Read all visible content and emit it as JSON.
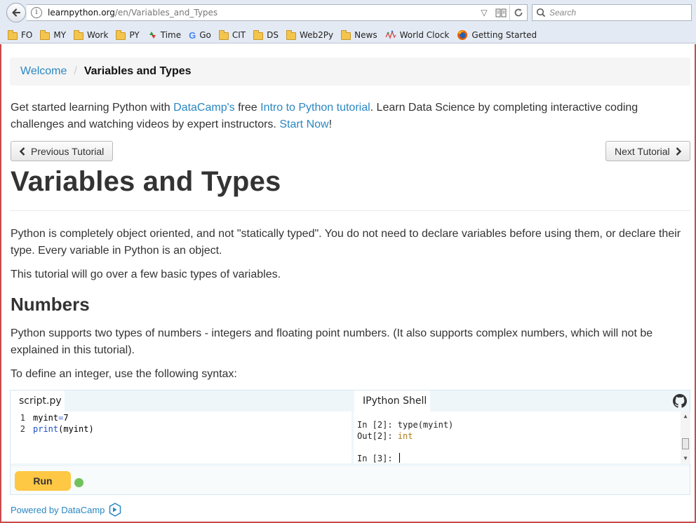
{
  "browser": {
    "url_host": "learnpython.org",
    "url_path": "/en/Variables_and_Types",
    "search_placeholder": "Search",
    "bookmarks": [
      {
        "label": "FO",
        "icon": "folder-icon"
      },
      {
        "label": "MY",
        "icon": "folder-icon"
      },
      {
        "label": "Work",
        "icon": "folder-icon"
      },
      {
        "label": "PY",
        "icon": "folder-icon"
      },
      {
        "label": "Time",
        "icon": "time-site-icon"
      },
      {
        "label": "Go",
        "icon": "google-icon"
      },
      {
        "label": "CIT",
        "icon": "folder-icon"
      },
      {
        "label": "DS",
        "icon": "folder-icon"
      },
      {
        "label": "Web2Py",
        "icon": "folder-icon"
      },
      {
        "label": "News",
        "icon": "folder-icon"
      },
      {
        "label": "World Clock",
        "icon": "world-clock-icon"
      },
      {
        "label": "Getting Started",
        "icon": "firefox-icon"
      }
    ]
  },
  "breadcrumb": {
    "home": "Welcome",
    "current": "Variables and Types"
  },
  "intro": {
    "t1": "Get started learning Python with ",
    "link1": "DataCamp's",
    "t2": " free ",
    "link2": "Intro to Python tutorial",
    "t3": ". Learn Data Science by completing interactive coding challenges and watching videos by expert instructors. ",
    "link3": "Start Now",
    "t4": "!"
  },
  "nav": {
    "prev": "Previous Tutorial",
    "next": "Next Tutorial"
  },
  "content": {
    "title": "Variables and Types",
    "p1": "Python is completely object oriented, and not \"statically typed\". You do not need to declare variables before using them, or declare their type. Every variable in Python is an object.",
    "p2": "This tutorial will go over a few basic types of variables.",
    "h2": "Numbers",
    "p3": "Python supports two types of numbers - integers and floating point numbers. (It also supports complex numbers, which will not be explained in this tutorial).",
    "p4": "To define an integer, use the following syntax:"
  },
  "widget": {
    "editor_tab": "script.py",
    "shell_tab": "IPython Shell",
    "code": {
      "line1_no": "1",
      "line1_var": "myint",
      "line1_op": " = ",
      "line1_val": "7",
      "line2_no": "2",
      "line2_fn": "print",
      "line2_args": "(myint)"
    },
    "shell": {
      "l1": "In [2]: type(myint)",
      "l2_prefix": "Out[2]: ",
      "l2_value": "int",
      "l3": "In [3]: "
    },
    "run_label": "Run",
    "status_color": "#71c25a"
  },
  "footer": {
    "powered": "Powered by DataCamp"
  },
  "colors": {
    "link": "#2a87c2",
    "run_button": "#ffc844"
  }
}
